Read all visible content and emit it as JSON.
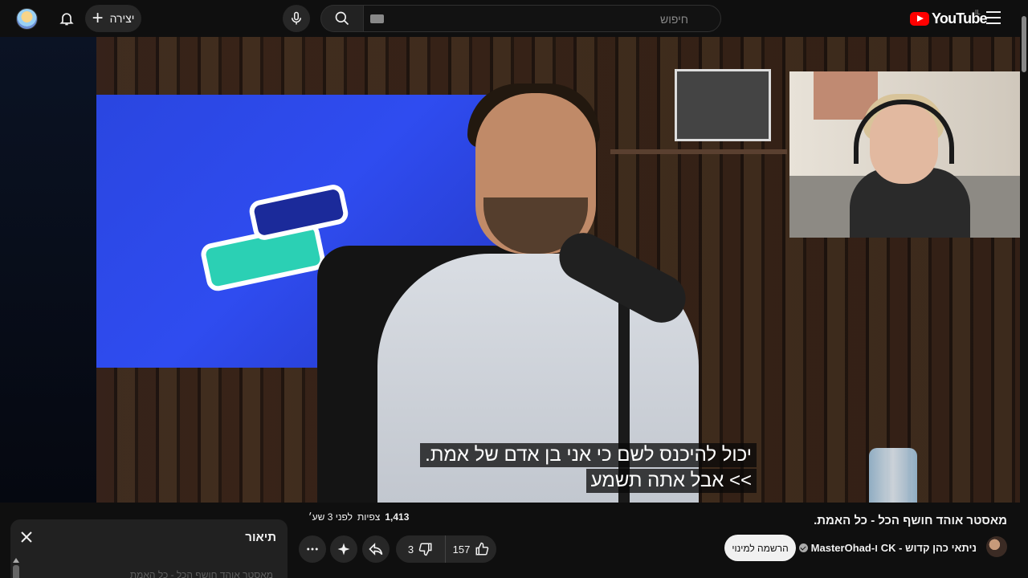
{
  "header": {
    "create_label": "יצירה",
    "search_placeholder": "חיפוש",
    "logo_text": "YouTube",
    "country_code": "IL",
    "icons": {
      "avatar": "user-avatar",
      "notifications": "bell-icon",
      "create": "plus-icon",
      "voice": "mic-icon",
      "search": "search-icon",
      "keyboard": "keyboard-icon",
      "menu": "hamburger-icon"
    }
  },
  "video": {
    "caption_line1": "יכול להיכנס לשם כי אני בן אדם של אמת.",
    "caption_line2": ">> אבל אתה תשמע"
  },
  "info": {
    "title": "מאסטר אוהד חושף הכל - כל האמת.",
    "channel": "ניתאי כהן קדוש - CK ו-MasterOhad",
    "join_label": "הרשמה למינוי",
    "views": "1,413",
    "views_suffix": "צפיות",
    "age": "לפני 3 שע׳",
    "likes": "157",
    "dislikes": "3"
  },
  "description": {
    "title": "תיאור",
    "snippet": "מאסטר אוהד חושף הכל - כל האמת"
  },
  "colors": {
    "background": "#0f0f0f",
    "button_bg": "#272727",
    "brand_red": "#ff0000",
    "join_bg": "#f1f1f1"
  }
}
